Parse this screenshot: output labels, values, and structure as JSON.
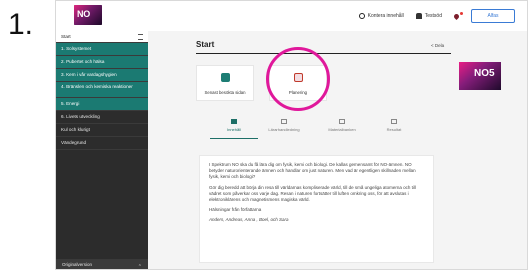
{
  "step_number": "1.",
  "header": {
    "logo_text": "NO",
    "tools": [
      {
        "icon": "gear-icon",
        "label": "Kontera innehåll"
      },
      {
        "icon": "person-icon",
        "label": "Testsöd"
      }
    ],
    "logout_label": "Alfas"
  },
  "sidebar": {
    "top_label": "Start",
    "items": [
      "1. Solsystemet",
      "2. Pubertet och hälsa",
      "3. Kem i vår vardagshygien",
      "4. Bränslen och kemiska reaktioner",
      "5. Energi",
      "6. Livets utveckling",
      "Kul och klurigt",
      "Vändegrund"
    ],
    "bottom_label": "Originalversion"
  },
  "main": {
    "title": "Start",
    "share_label": "Dela",
    "cards": [
      {
        "label": "Senast besökta sidan"
      },
      {
        "label": "Planering"
      }
    ],
    "book_title": "NO5",
    "tabs": [
      {
        "label": "Innehåll"
      },
      {
        "label": "Lärarhandledning"
      },
      {
        "label": "Materialbanken"
      },
      {
        "label": "Resultat"
      }
    ],
    "content": {
      "p1": "I Spektrum NO ska du få lära dig om fysik, kemi och biologi. De kallas gemensamt för NO-ämnen. NO betyder naturorienterande ämnen och handlar om just naturen. Men vad är egentligen skillnaden mellan fysik, kemi och biologi?",
      "p2": "Gör dig beredd att börja din resa till världarnas kompliserade värld, till de små ungeliga atomerna och till vädret som påverkar oss varje dag. Resan i naturen fortsätter till luften omkring oss, för att avslutas i elektroniklärens och magnetismens magiska värld.",
      "greeting": "Hälsningar från författarna",
      "authors": "Anders, Andreas, Anna , Boel, och Sara"
    }
  }
}
